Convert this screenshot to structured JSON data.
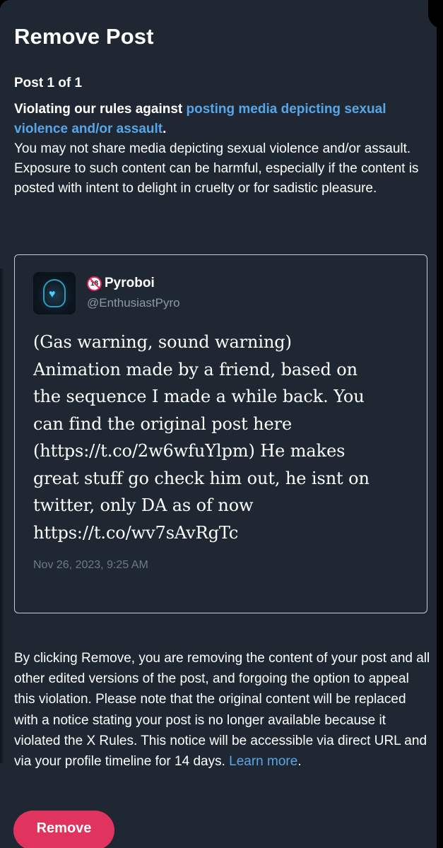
{
  "dialog": {
    "title": "Remove Post",
    "post_count": "Post 1 of 1",
    "violation_lead": "Violating our rules against ",
    "violation_link": "posting media depicting sexual violence and/or assault",
    "violation_period": ".",
    "violation_description": "You may not share media depicting sexual violence and/or assault. Exposure to such content can be harmful, especially if the content is posted with intent to delight in cruelty or for sadistic pleasure."
  },
  "post": {
    "badge_icon": "no-under-18-icon",
    "display_name": "Pyroboi",
    "handle": "@EnthusiastPyro",
    "text": "(Gas warning, sound warning)\nAnimation made by a friend, based on\nthe sequence I made a while back. You\ncan find the original post here\n(https://t.co/2w6wfuYlpm) He makes\ngreat stuff go check him out, he isnt on\ntwitter, only DA as of now\nhttps://t.co/wv7sAvRgTc",
    "timestamp": "Nov 26, 2023, 9:25 AM"
  },
  "notice": {
    "text": "By clicking Remove, you are removing the content of your post and all other edited versions of the post, and forgoing the option to appeal this violation. Please note that the original content will be replaced with a notice stating your post is no longer available because it violated the X Rules. This notice will be accessible via direct URL and via your profile timeline for 14 days. ",
    "learn_more": "Learn more",
    "period": "."
  },
  "actions": {
    "remove_label": "Remove"
  },
  "colors": {
    "background": "#1e2732",
    "link": "#58a6e8",
    "remove_button": "#e0345f",
    "muted_text": "#8b98a5"
  }
}
